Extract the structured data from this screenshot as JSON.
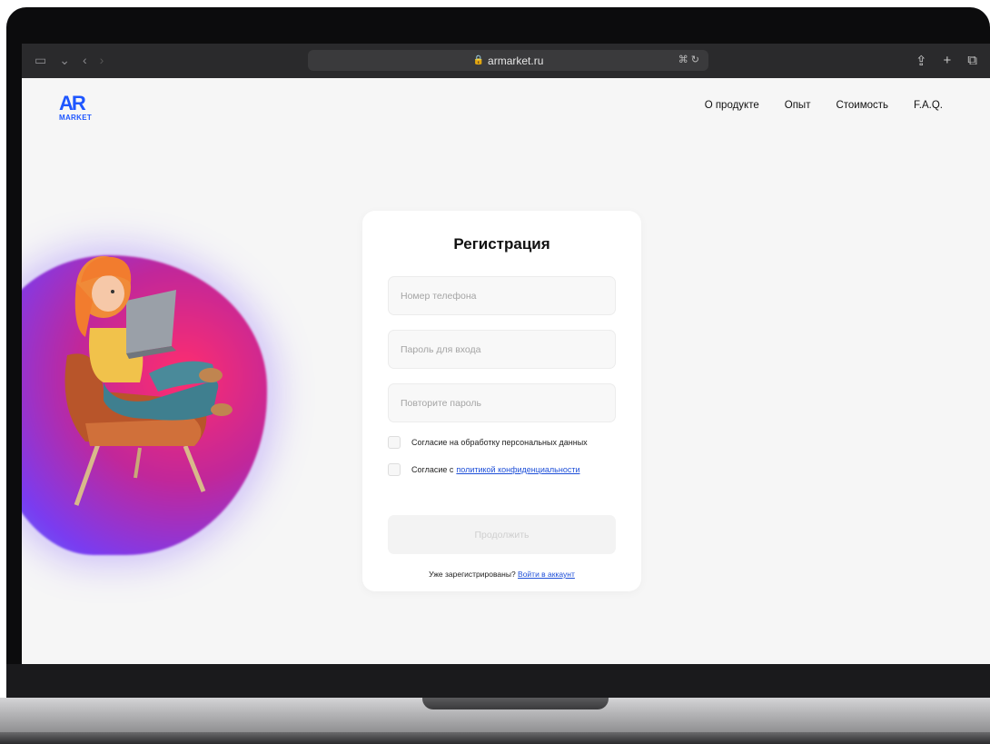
{
  "browser": {
    "url": "armarket.ru",
    "extra": "⌘ ↻"
  },
  "logo": {
    "mark": "AR",
    "word": "MARKET"
  },
  "nav": {
    "items": [
      "О продукте",
      "Опыт",
      "Стоимость",
      "F.A.Q."
    ]
  },
  "form": {
    "title": "Регистрация",
    "phone_placeholder": "Номер телефона",
    "password_placeholder": "Пароль для входа",
    "repeat_placeholder": "Повторите пароль",
    "consent1": "Согласие на обработку персональных данных",
    "consent2_prefix": "Согласие с ",
    "consent2_link": "политикой конфиденциальности",
    "submit": "Продолжить",
    "footer_prefix": "Уже зарегистрированы? ",
    "footer_link": "Войти в аккаунт"
  },
  "colors": {
    "brand": "#1e56ff",
    "link": "#1e4fd8",
    "blob_pink": "#ff2d6e",
    "blob_purple": "#7a3cf0"
  }
}
